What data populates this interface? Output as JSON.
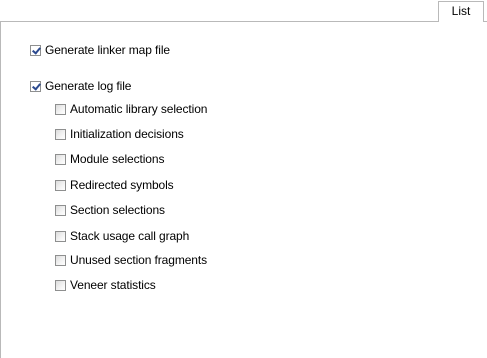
{
  "tabs": [
    {
      "label": "List",
      "active": true
    }
  ],
  "options": {
    "linker_map": {
      "label": "Generate linker map file",
      "checked": true
    },
    "log_file": {
      "label": "Generate log file",
      "checked": true
    },
    "log_items": [
      {
        "label": "Automatic library selection",
        "checked": false
      },
      {
        "label": "Initialization decisions",
        "checked": false
      },
      {
        "label": "Module selections",
        "checked": false
      },
      {
        "label": "Redirected symbols",
        "checked": false
      },
      {
        "label": "Section selections",
        "checked": false
      },
      {
        "label": "Stack usage call graph",
        "checked": false
      },
      {
        "label": "Unused section fragments",
        "checked": false
      },
      {
        "label": "Veneer statistics",
        "checked": false
      }
    ]
  },
  "colors": {
    "border": "#b9b9b9",
    "checkmark": "#2c4a8f",
    "checkbox_border": "#8e8f8f"
  }
}
